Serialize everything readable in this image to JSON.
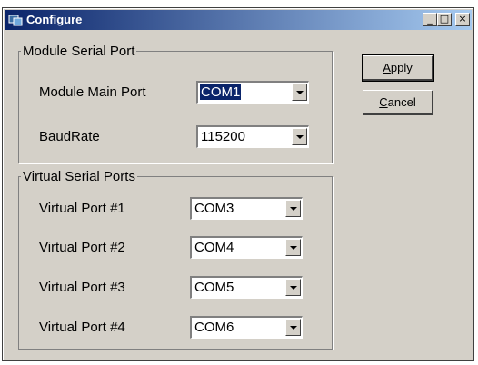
{
  "window": {
    "title": "Configure",
    "controls": {
      "minimize": "_",
      "maximize": "□",
      "close": "×"
    }
  },
  "module_group": {
    "legend": "Module Serial Port",
    "main_port": {
      "label": "Module Main Port",
      "value": "COM1"
    },
    "baudrate": {
      "label": "BaudRate",
      "value": "115200"
    }
  },
  "virtual_group": {
    "legend": "Virtual Serial Ports",
    "ports": [
      {
        "label": "Virtual Port #1",
        "value": "COM3"
      },
      {
        "label": "Virtual Port #2",
        "value": "COM4"
      },
      {
        "label": "Virtual Port #3",
        "value": "COM5"
      },
      {
        "label": "Virtual Port #4",
        "value": "COM6"
      }
    ]
  },
  "buttons": {
    "apply": {
      "first": "A",
      "rest": "pply"
    },
    "cancel": {
      "first": "C",
      "rest": "ancel"
    }
  },
  "icons": {
    "app": "window-app-icon",
    "dropdown": "chevron-down-icon"
  },
  "colors": {
    "titlebar_start": "#0a246a",
    "titlebar_end": "#a6caf0",
    "face": "#d4d0c8"
  }
}
